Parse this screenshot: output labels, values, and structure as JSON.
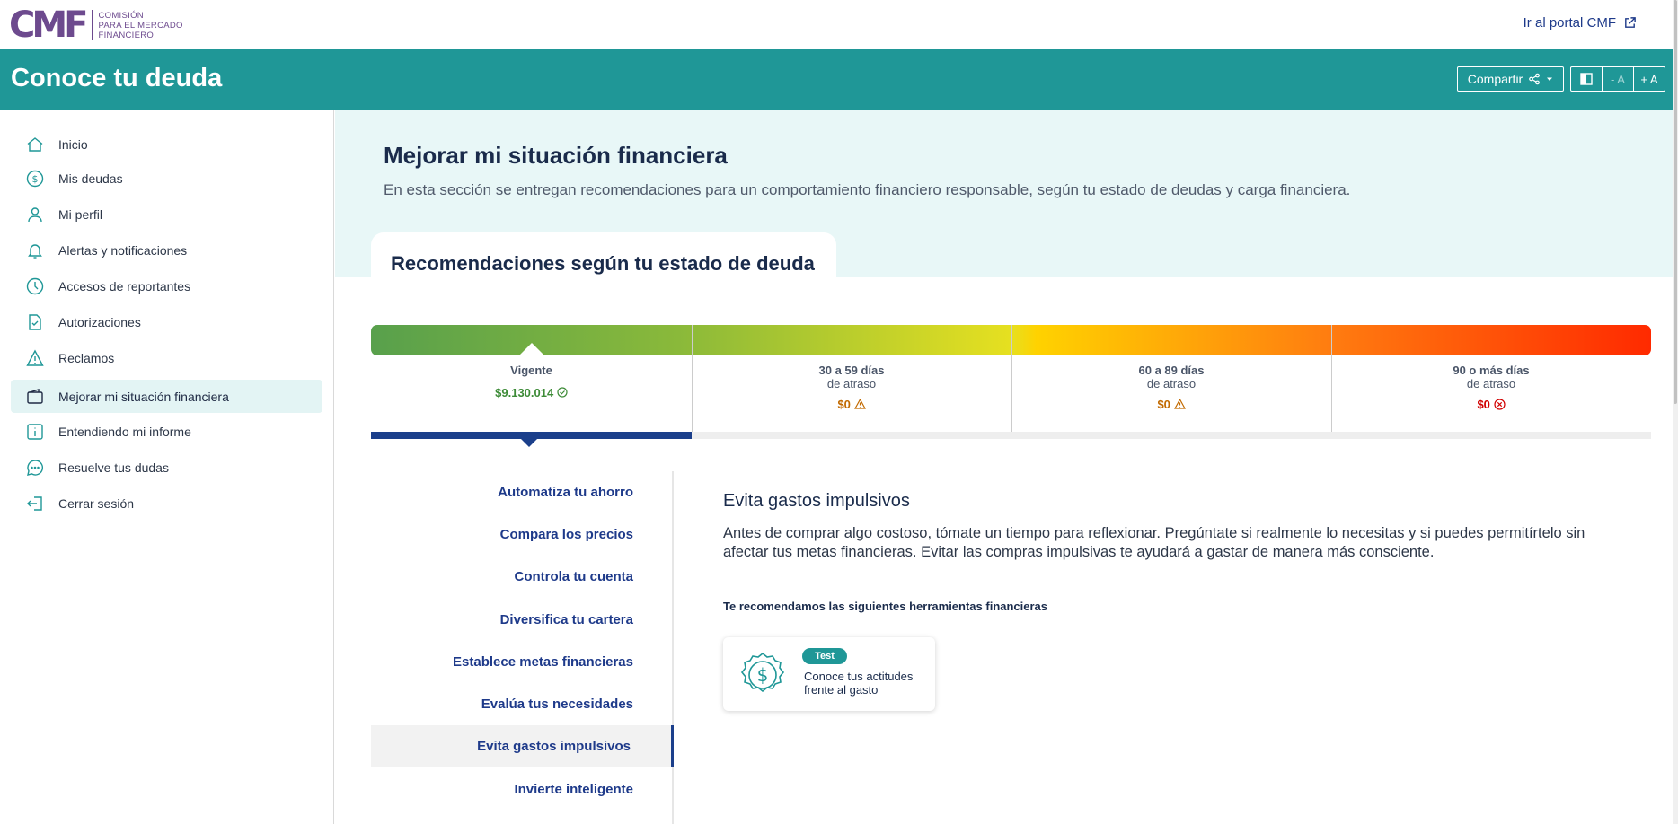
{
  "brand": {
    "logo_mark": "CMF",
    "logo_lines": [
      "COMISIÓN",
      "PARA EL MERCADO",
      "FINANCIERO"
    ],
    "portal_link": "Ir al portal CMF"
  },
  "header": {
    "title": "Conoce tu deuda",
    "share_label": "Compartir",
    "font_decrease": "- A",
    "font_increase": "+ A"
  },
  "sidebar": {
    "items": [
      {
        "label": "Inicio",
        "icon": "home-icon"
      },
      {
        "label": "Mis deudas",
        "icon": "dollar-circle-icon"
      },
      {
        "label": "Mi perfil",
        "icon": "user-icon"
      },
      {
        "label": "Alertas y notificaciones",
        "icon": "bell-icon"
      },
      {
        "label": "Accesos de reportantes",
        "icon": "clock-icon"
      },
      {
        "label": "Autorizaciones",
        "icon": "document-check-icon"
      },
      {
        "label": "Reclamos",
        "icon": "warning-icon"
      },
      {
        "label": "Mejorar mi situación financiera",
        "icon": "wallet-icon",
        "active": true
      },
      {
        "label": "Entendiendo mi informe",
        "icon": "info-icon"
      },
      {
        "label": "Resuelve tus dudas",
        "icon": "chat-icon"
      },
      {
        "label": "Cerrar sesión",
        "icon": "logout-icon"
      }
    ]
  },
  "hero": {
    "title": "Mejorar mi situación financiera",
    "description": "En esta sección se entregan recomendaciones para un comportamiento financiero responsable, según tu estado de deudas y carga financiera."
  },
  "recommendations": {
    "tab_title": "Recomendaciones según tu estado de deuda",
    "segments": [
      {
        "title": "Vigente",
        "subtitle": "",
        "amount": "$9.130.014",
        "status": "ok",
        "color": "#3d8b37"
      },
      {
        "title": "30 a 59 días",
        "subtitle": "de atraso",
        "amount": "$0",
        "status": "warning",
        "color": "#c26a00"
      },
      {
        "title": "60 a 89 días",
        "subtitle": "de atraso",
        "amount": "$0",
        "status": "warning",
        "color": "#c26a00"
      },
      {
        "title": "90 o más días",
        "subtitle": "de atraso",
        "amount": "$0",
        "status": "error",
        "color": "#d10000"
      }
    ]
  },
  "tips": {
    "items": [
      "Automatiza tu ahorro",
      "Compara los precios",
      "Controla tu cuenta",
      "Diversifica tu cartera",
      "Establece metas financieras",
      "Evalúa tus necesidades",
      "Evita gastos impulsivos",
      "Invierte inteligente"
    ],
    "active_index": 6
  },
  "content": {
    "title": "Evita gastos impulsivos",
    "body": "Antes de comprar algo costoso, tómate un tiempo para reflexionar. Pregúntate si realmente lo necesitas y si puedes permitírtelo sin afectar tus metas financieras. Evitar las compras impulsivas te ayudará a gastar de manera más consciente.",
    "tools_heading": "Te recomendamos las siguientes herramientas financieras",
    "tool": {
      "badge": "Test",
      "label": "Conoce tus actitudes frente al gasto",
      "icon": "money-badge-icon"
    }
  },
  "colors": {
    "teal": "#1f9797",
    "navy": "#1b3f8b",
    "brand_purple": "#6d4a8e"
  }
}
